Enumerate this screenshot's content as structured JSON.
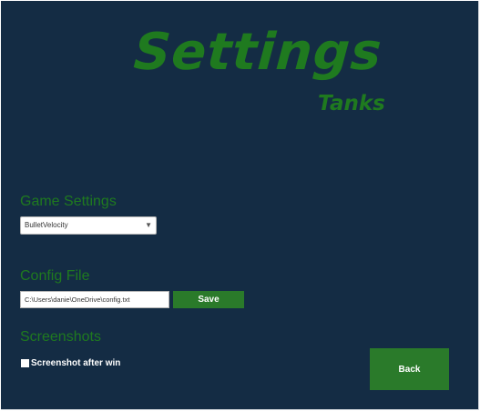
{
  "logo": {
    "title": "Settings",
    "subtitle": "Tanks"
  },
  "game_settings": {
    "heading": "Game Settings",
    "selected_option": "BulletVelocity"
  },
  "config_file": {
    "heading": "Config File",
    "path_value": "C:\\Users\\danie\\OneDrive\\config.txt",
    "save_label": "Save"
  },
  "screenshots": {
    "heading": "Screenshots",
    "checkbox_label": "Screenshot after win",
    "checked": false
  },
  "footer": {
    "back_label": "Back"
  },
  "colors": {
    "background": "#142c44",
    "accent_green": "#1f7a1f",
    "button_green": "#2a7a2a",
    "text_white": "#ffffff"
  },
  "icons": {
    "dropdown": "chevron-down-icon"
  }
}
